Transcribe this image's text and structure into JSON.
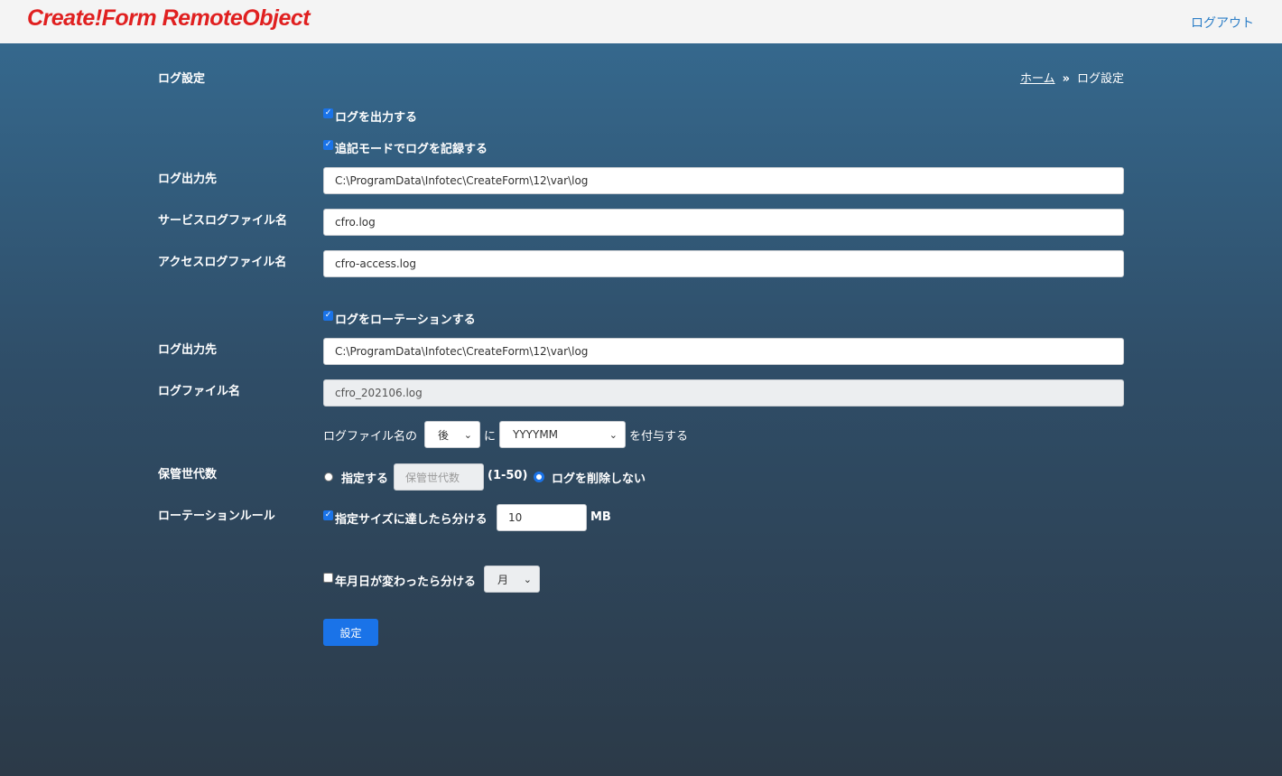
{
  "header": {
    "logo": "Create!Form RemoteObject",
    "logout": "ログアウト"
  },
  "page": {
    "title": "ログ設定",
    "breadcrumb": {
      "home": "ホーム",
      "sep": "»",
      "current": "ログ設定"
    }
  },
  "form": {
    "enable_log": {
      "label": "ログを出力する",
      "checked": true
    },
    "append_mode": {
      "label": "追記モードでログを記録する",
      "checked": true
    },
    "log_dest": {
      "label": "ログ出力先",
      "value": "C:\\ProgramData\\Infotec\\CreateForm\\12\\var\\log"
    },
    "service_log": {
      "label": "サービスログファイル名",
      "value": "cfro.log"
    },
    "access_log": {
      "label": "アクセスログファイル名",
      "value": "cfro-access.log"
    },
    "rotate": {
      "label": "ログをローテーションする",
      "checked": true
    },
    "rotate_dest": {
      "label": "ログ出力先",
      "value": "C:\\ProgramData\\Infotec\\CreateForm\\12\\var\\log"
    },
    "rotate_filename": {
      "label": "ログファイル名",
      "value": "cfro_202106.log"
    },
    "suffix": {
      "prefix": "ログファイル名の",
      "position": "後",
      "mid": "に",
      "format": "YYYYMM",
      "suffix": "を付与する"
    },
    "generations": {
      "label": "保管世代数",
      "opt_specify": "指定する",
      "placeholder": "保管世代数",
      "range": "(1-50)",
      "opt_keep": "ログを削除しない",
      "selected": "ログを削除しない"
    },
    "rotation_rule": {
      "label": "ローテーションルール",
      "by_size": {
        "label": "指定サイズに達したら分ける",
        "checked": true,
        "value": "10",
        "unit": "MB"
      },
      "by_date": {
        "label": "年月日が変わったら分ける",
        "checked": false,
        "period": "月"
      }
    },
    "submit": "設定"
  },
  "colors": {
    "accent": "#1a73e8",
    "logo": "#e02020",
    "link": "#2e7fc7"
  }
}
